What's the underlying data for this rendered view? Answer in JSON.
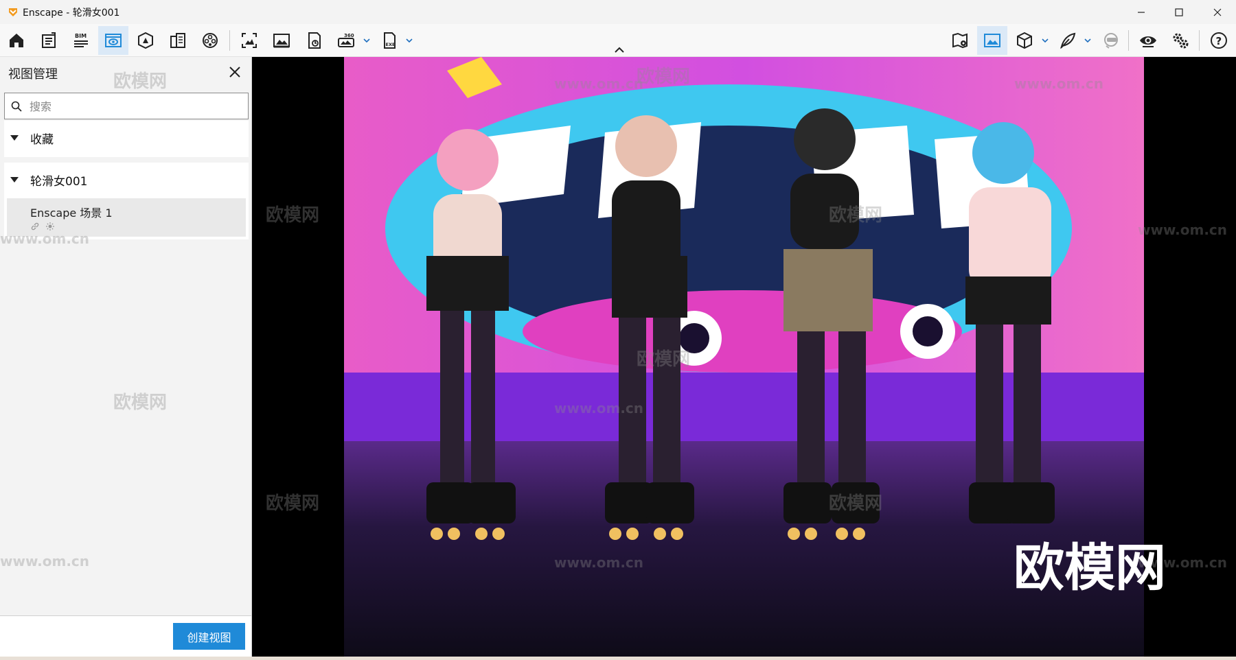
{
  "window": {
    "title": "Enscape - 轮滑女001"
  },
  "colors": {
    "accent": "#1f8ad8",
    "active_tool_bg": "#dbe9f7",
    "logo": "#f29a1e"
  },
  "toolbar": {
    "left_tools": [
      {
        "name": "home-icon",
        "active": false
      },
      {
        "name": "project-info-icon",
        "active": false
      },
      {
        "name": "bim-icon",
        "label": "BIM",
        "active": false
      },
      {
        "name": "view-management-icon",
        "active": true
      },
      {
        "name": "atmosphere-icon",
        "active": false
      },
      {
        "name": "asset-library-icon",
        "active": false
      },
      {
        "name": "material-icon",
        "active": false
      },
      {
        "name": "capture-icon",
        "active": false
      },
      {
        "name": "render-image-icon",
        "active": false
      },
      {
        "name": "panorama-icon",
        "label": "360",
        "active": false
      },
      {
        "name": "export-exe-icon",
        "label": "EXE",
        "active": false
      }
    ],
    "right_tools": [
      {
        "name": "map-icon"
      },
      {
        "name": "image-view-icon"
      },
      {
        "name": "cube-icon"
      },
      {
        "name": "feather-icon"
      },
      {
        "name": "vr-headset-icon"
      },
      {
        "name": "visibility-icon"
      },
      {
        "name": "settings-icon"
      },
      {
        "name": "help-icon"
      }
    ]
  },
  "panel": {
    "title": "视图管理",
    "search": {
      "placeholder": "搜索",
      "value": ""
    },
    "groups": [
      {
        "label": "收藏",
        "expanded": true
      },
      {
        "label": "轮滑女001",
        "expanded": true,
        "views": [
          {
            "name": "Enscape 场景 1",
            "icons": [
              "link-icon",
              "sun-icon"
            ]
          }
        ]
      }
    ],
    "create_button": "创建视图"
  },
  "viewport": {
    "watermark_big": "欧模网",
    "watermark_small": "欧模网",
    "watermark_url": "www.om.cn"
  }
}
